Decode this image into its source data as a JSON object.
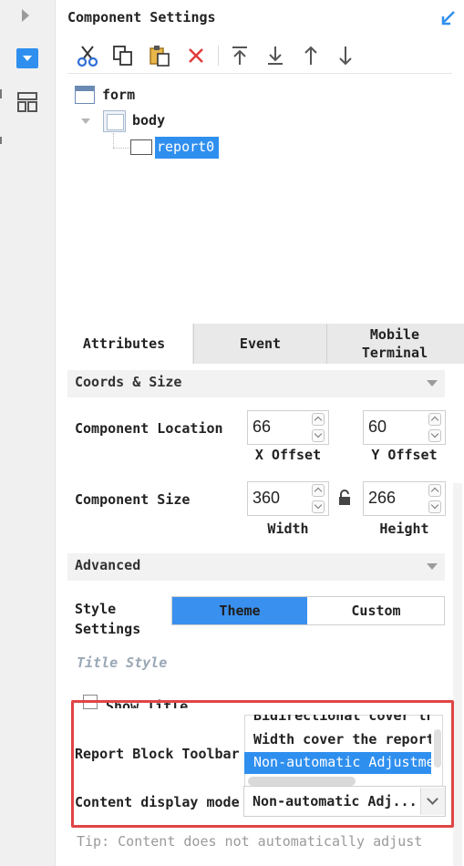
{
  "header": {
    "title": "Component Settings",
    "pin_icon": "pin-icon"
  },
  "toolbar": {
    "icons": [
      "cut-icon",
      "copy-icon",
      "paste-icon",
      "delete-icon",
      "move-top-icon",
      "move-bottom-icon",
      "move-up-icon",
      "move-down-icon"
    ]
  },
  "tree": {
    "form": "form",
    "body": "body",
    "report": "report0"
  },
  "tabs": {
    "attributes": "Attributes",
    "event": "Event",
    "mobile": "Mobile\nTerminal"
  },
  "coords": {
    "section_title": "Coords & Size",
    "location_label": "Component Location",
    "x_value": "66",
    "y_value": "60",
    "x_label": "X Offset",
    "y_label": "Y Offset",
    "size_label": "Component Size",
    "width_value": "360",
    "height_value": "266",
    "width_label": "Width",
    "height_label": "Height"
  },
  "advanced": {
    "section_title": "Advanced",
    "style_label": "Style\nSettings",
    "theme": "Theme",
    "custom": "Custom",
    "title_style": "Title Style",
    "show_title": "Show Title",
    "toolbar_label": "Report Block Toolbar",
    "dropdown_options": [
      "Bidirectional cover th",
      "Width cover the report",
      "Non-automatic Adjustme"
    ],
    "content_mode_label": "Content display mode",
    "content_mode_value": "Non-automatic Adj...",
    "tip": "Tip: Content does not automatically adjust"
  },
  "colors": {
    "accent": "#2f8fef",
    "highlight": "#e04545"
  }
}
